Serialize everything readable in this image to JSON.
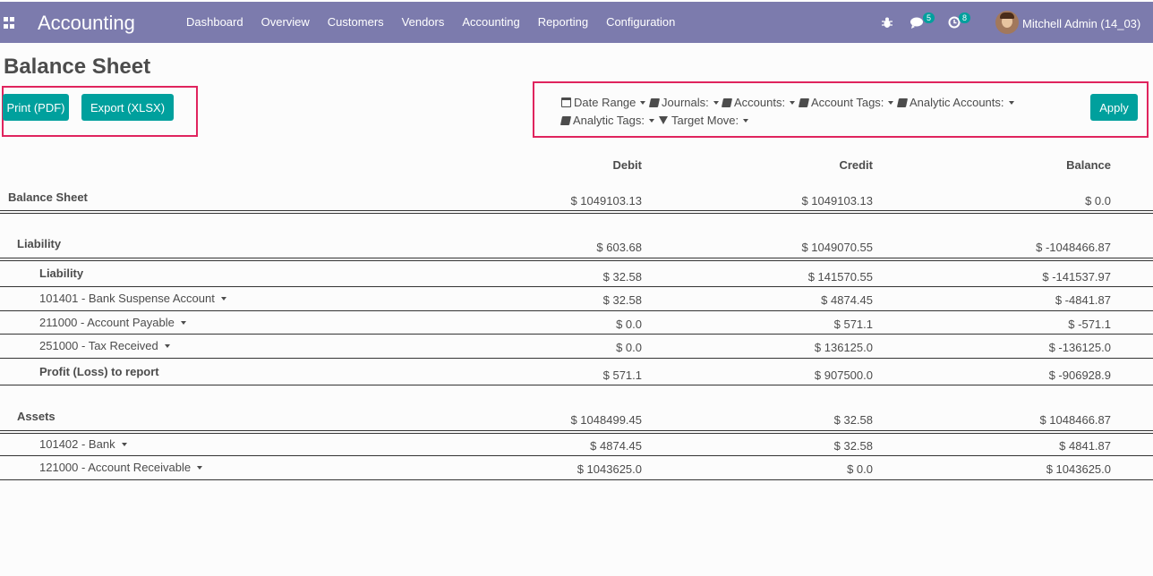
{
  "navbar": {
    "app_name": "Accounting",
    "menu": [
      "Dashboard",
      "Overview",
      "Customers",
      "Vendors",
      "Accounting",
      "Reporting",
      "Configuration"
    ],
    "messages_badge": "5",
    "activities_badge": "8",
    "user": "Mitchell Admin (14_03)"
  },
  "page": {
    "title": "Balance Sheet"
  },
  "actions": {
    "print": "Print (PDF)",
    "export": "Export (XLSX)",
    "apply": "Apply"
  },
  "filters": {
    "date_range": "Date Range",
    "journals": "Journals:",
    "accounts": "Accounts:",
    "account_tags": "Account Tags:",
    "analytic_accounts": "Analytic Accounts:",
    "analytic_tags": "Analytic Tags:",
    "target_move": "Target Move:"
  },
  "table": {
    "columns": [
      "Debit",
      "Credit",
      "Balance"
    ],
    "rows": [
      {
        "label": "Balance Sheet",
        "debit": "$ 1049103.13",
        "credit": "$ 1049103.13",
        "balance": "$ 0.0"
      },
      {
        "label": "Liability",
        "debit": "$ 603.68",
        "credit": "$ 1049070.55",
        "balance": "$ -1048466.87"
      },
      {
        "label": "Liability",
        "debit": "$ 32.58",
        "credit": "$ 141570.55",
        "balance": "$ -141537.97"
      },
      {
        "label": "101401 - Bank Suspense Account",
        "debit": "$ 32.58",
        "credit": "$ 4874.45",
        "balance": "$ -4841.87"
      },
      {
        "label": "211000 - Account Payable",
        "debit": "$ 0.0",
        "credit": "$ 571.1",
        "balance": "$ -571.1"
      },
      {
        "label": "251000 - Tax Received",
        "debit": "$ 0.0",
        "credit": "$ 136125.0",
        "balance": "$ -136125.0"
      },
      {
        "label": "Profit (Loss) to report",
        "debit": "$ 571.1",
        "credit": "$ 907500.0",
        "balance": "$ -906928.9"
      },
      {
        "label": "Assets",
        "debit": "$ 1048499.45",
        "credit": "$ 32.58",
        "balance": "$ 1048466.87"
      },
      {
        "label": "101402 - Bank",
        "debit": "$ 4874.45",
        "credit": "$ 32.58",
        "balance": "$ 4841.87"
      },
      {
        "label": "121000 - Account Receivable",
        "debit": "$ 1043625.0",
        "credit": "$ 0.0",
        "balance": "$ 1043625.0"
      }
    ]
  },
  "colors": {
    "navbar": "#7c7bad",
    "button": "#00a09d",
    "highlight": "#e0245e"
  }
}
